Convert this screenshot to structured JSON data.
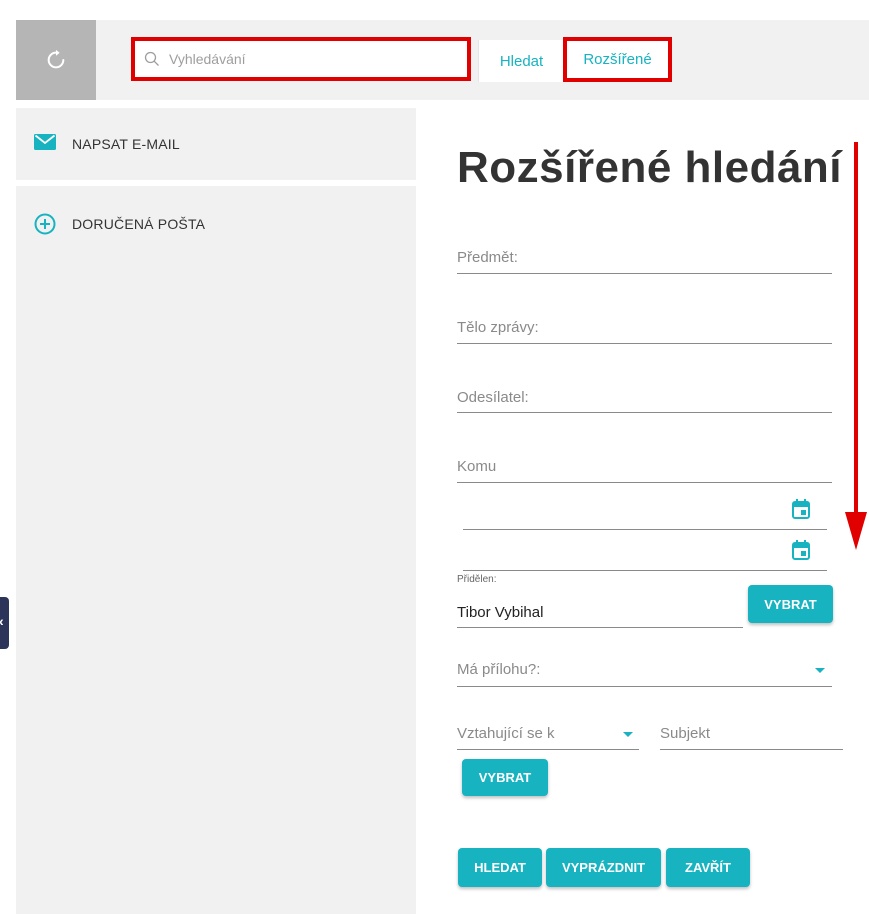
{
  "header": {
    "search": {
      "placeholder": "Vyhledávání",
      "value": ""
    },
    "search_button": "Hledat",
    "advanced_button": "Rozšířené"
  },
  "sidebar": {
    "items": [
      {
        "label": "NAPSAT E-MAIL",
        "icon": "mail-icon"
      },
      {
        "label": "DORUČENÁ POŠTA",
        "icon": "plus-circle-icon"
      }
    ]
  },
  "form": {
    "title": "Rozšířené hledání",
    "subject_label": "Předmět:",
    "body_label": "Tělo zprávy:",
    "sender_label": "Odesílatel:",
    "to_label": "Komu",
    "assigned_label": "Přidělen:",
    "assigned_value": "Tibor Vybihal",
    "choose_button": "VYBRAT",
    "has_attachment_label": "Má přílohu?:",
    "related_label": "Vztahující se k",
    "entity_label": "Subjekt",
    "choose_button_2": "VYBRAT",
    "search_button": "HLEDAT",
    "clear_button": "VYPRÁZDNIT",
    "close_button": "ZAVŘÍT"
  },
  "colors": {
    "accent": "#18b3c0",
    "highlight_red": "#e00000",
    "sidebar_bg": "#f1f1f1",
    "nav_dark": "#2c3559"
  }
}
